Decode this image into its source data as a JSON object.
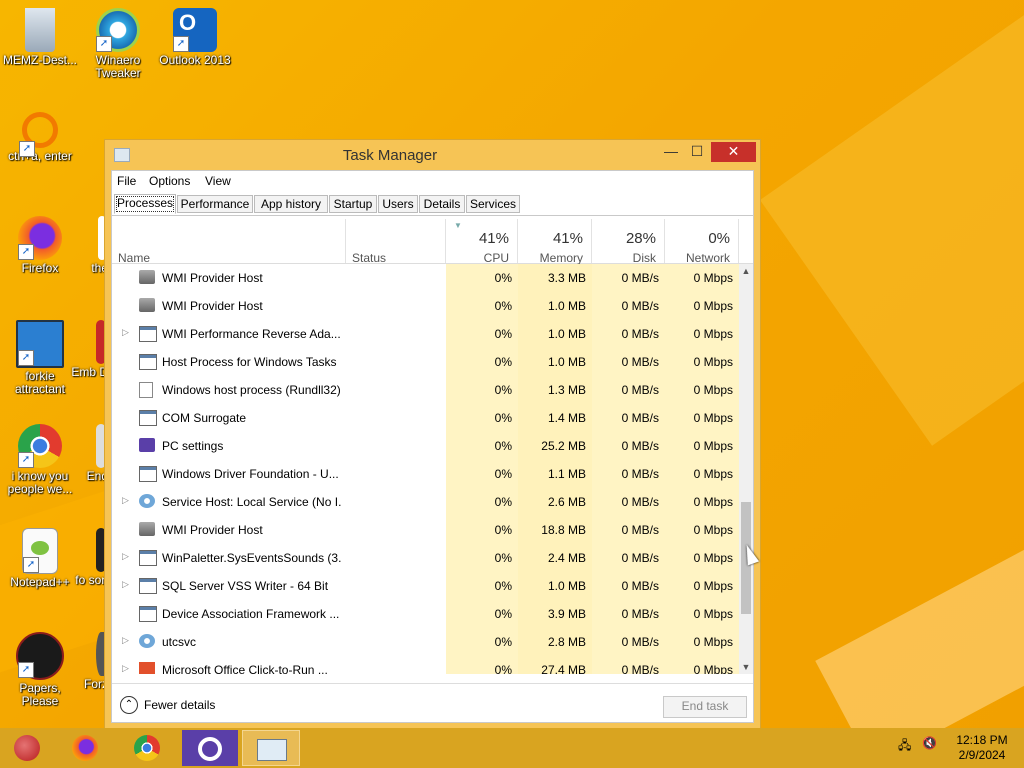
{
  "desktop": {
    "icons": [
      {
        "label": "MEMZ-Dest...",
        "icon": "recycle-bin-icon"
      },
      {
        "label": "Winaero Tweaker",
        "icon": "winaero-icon"
      },
      {
        "label": "Outlook 2013",
        "icon": "outlook-icon"
      },
      {
        "label": "ctrl+a, enter",
        "icon": "magnifier-icon"
      },
      {
        "label": "Firefox",
        "icon": "firefox-icon"
      },
      {
        "label": "forkie attractant",
        "icon": "monitor-gear-icon"
      },
      {
        "label": "i know you people we...",
        "icon": "chrome-icon"
      },
      {
        "label": "Notepad++",
        "icon": "notepadpp-icon"
      },
      {
        "label": "Papers, Please",
        "icon": "papers-please-icon"
      },
      {
        "label": "the",
        "icon": "partial-icon"
      },
      {
        "label": "Emb D",
        "icon": "partial-icon"
      },
      {
        "label": "End",
        "icon": "partial-icon"
      },
      {
        "label": "fo son",
        "icon": "partial-icon"
      },
      {
        "label": "Forz",
        "icon": "partial-icon"
      }
    ]
  },
  "window": {
    "title": "Task Manager",
    "min": "—",
    "max": "☐",
    "close": "✕"
  },
  "menu": {
    "file": "File",
    "options": "Options",
    "view": "View"
  },
  "tabs": [
    "Processes",
    "Performance",
    "App history",
    "Startup",
    "Users",
    "Details",
    "Services"
  ],
  "columns": {
    "name": "Name",
    "status": "Status",
    "cpu": {
      "pct": "41%",
      "label": "CPU"
    },
    "memory": {
      "pct": "41%",
      "label": "Memory"
    },
    "disk": {
      "pct": "28%",
      "label": "Disk"
    },
    "network": {
      "pct": "0%",
      "label": "Network"
    }
  },
  "processes": [
    {
      "name": "WMI Provider Host",
      "expandable": false,
      "icon": "wmi-icon",
      "cpu": "0%",
      "memory": "3.3 MB",
      "disk": "0 MB/s",
      "network": "0 Mbps"
    },
    {
      "name": "WMI Provider Host",
      "expandable": false,
      "icon": "wmi-icon",
      "cpu": "0%",
      "memory": "1.0 MB",
      "disk": "0 MB/s",
      "network": "0 Mbps"
    },
    {
      "name": "WMI Performance Reverse Ada...",
      "expandable": true,
      "icon": "window-icon",
      "cpu": "0%",
      "memory": "1.0 MB",
      "disk": "0 MB/s",
      "network": "0 Mbps"
    },
    {
      "name": "Host Process for Windows Tasks",
      "expandable": false,
      "icon": "window-icon",
      "cpu": "0%",
      "memory": "1.0 MB",
      "disk": "0 MB/s",
      "network": "0 Mbps"
    },
    {
      "name": "Windows host process (Rundll32)",
      "expandable": false,
      "icon": "document-icon",
      "cpu": "0%",
      "memory": "1.3 MB",
      "disk": "0 MB/s",
      "network": "0 Mbps"
    },
    {
      "name": "COM Surrogate",
      "expandable": false,
      "icon": "window-icon",
      "cpu": "0%",
      "memory": "1.4 MB",
      "disk": "0 MB/s",
      "network": "0 Mbps"
    },
    {
      "name": "PC settings",
      "expandable": false,
      "icon": "settings-gear-icon",
      "cpu": "0%",
      "memory": "25.2 MB",
      "disk": "0 MB/s",
      "network": "0 Mbps"
    },
    {
      "name": "Windows Driver Foundation - U...",
      "expandable": false,
      "icon": "window-icon",
      "cpu": "0%",
      "memory": "1.1 MB",
      "disk": "0 MB/s",
      "network": "0 Mbps"
    },
    {
      "name": "Service Host: Local Service (No I...",
      "expandable": true,
      "icon": "service-gear-icon",
      "cpu": "0%",
      "memory": "2.6 MB",
      "disk": "0 MB/s",
      "network": "0 Mbps"
    },
    {
      "name": "WMI Provider Host",
      "expandable": false,
      "icon": "wmi-icon",
      "cpu": "0%",
      "memory": "18.8 MB",
      "disk": "0 MB/s",
      "network": "0 Mbps"
    },
    {
      "name": "WinPaletter.SysEventsSounds (3...",
      "expandable": true,
      "icon": "window-icon",
      "cpu": "0%",
      "memory": "2.4 MB",
      "disk": "0 MB/s",
      "network": "0 Mbps"
    },
    {
      "name": "SQL Server VSS Writer - 64 Bit",
      "expandable": true,
      "icon": "window-icon",
      "cpu": "0%",
      "memory": "1.0 MB",
      "disk": "0 MB/s",
      "network": "0 Mbps"
    },
    {
      "name": "Device Association Framework ...",
      "expandable": false,
      "icon": "window-icon",
      "cpu": "0%",
      "memory": "3.9 MB",
      "disk": "0 MB/s",
      "network": "0 Mbps"
    },
    {
      "name": "utcsvc",
      "expandable": true,
      "icon": "service-gear-icon",
      "cpu": "0%",
      "memory": "2.8 MB",
      "disk": "0 MB/s",
      "network": "0 Mbps"
    },
    {
      "name": "Microsoft Office Click-to-Run ...",
      "expandable": true,
      "icon": "office-icon",
      "cpu": "0%",
      "memory": "27.4 MB",
      "disk": "0 MB/s",
      "network": "0 Mbps"
    }
  ],
  "footer": {
    "fewer_details": "Fewer details",
    "end_task": "End task"
  },
  "taskbar": {
    "items": [
      "ornament-icon",
      "firefox-icon",
      "chrome-icon",
      "settings-gear-icon",
      "task-manager-icon"
    ],
    "time": "12:18 PM",
    "date": "2/9/2024"
  },
  "colors": {
    "close": "#c7302a",
    "wallpaper": "#f4a600",
    "highlight_col": "#fff4c4"
  }
}
